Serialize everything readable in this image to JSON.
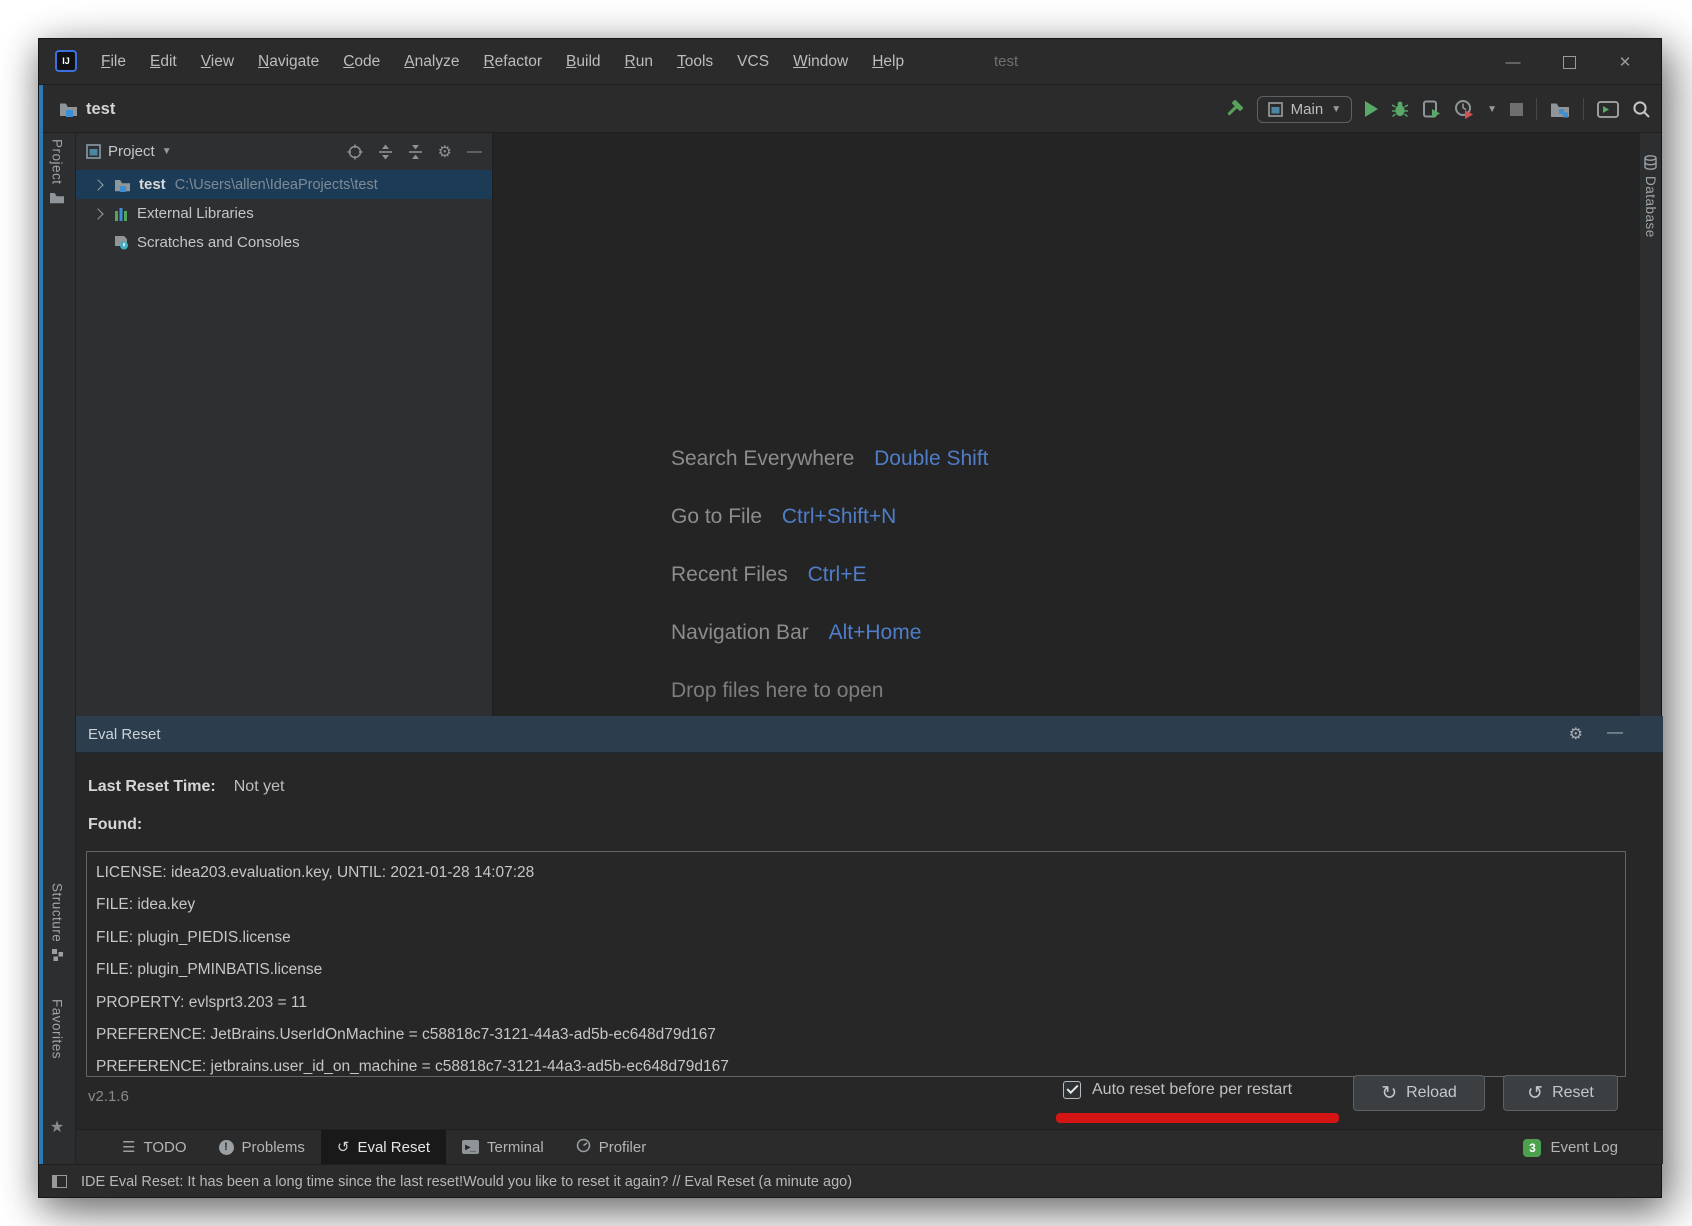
{
  "window": {
    "title": "test",
    "logo_text": "IJ",
    "controls": {
      "minimize": "—",
      "close": "✕"
    }
  },
  "menubar": {
    "items": [
      "File",
      "Edit",
      "View",
      "Navigate",
      "Code",
      "Analyze",
      "Refactor",
      "Build",
      "Run",
      "Tools",
      "VCS",
      "Window",
      "Help"
    ]
  },
  "toolbar": {
    "project_name": "test",
    "run_config": "Main"
  },
  "left_stripe": {
    "project_label": "Project",
    "structure_label": "Structure",
    "favorites_label": "Favorites"
  },
  "right_stripe": {
    "database_label": "Database"
  },
  "project_panel": {
    "header": "Project",
    "tree": [
      {
        "name": "test",
        "path": "C:\\Users\\allen\\IdeaProjects\\test"
      },
      {
        "name": "External Libraries"
      },
      {
        "name": "Scratches and Consoles"
      }
    ]
  },
  "editor_shortcuts": {
    "rows": [
      {
        "label": "Search Everywhere",
        "keys": "Double Shift"
      },
      {
        "label": "Go to File",
        "keys": "Ctrl+Shift+N"
      },
      {
        "label": "Recent Files",
        "keys": "Ctrl+E"
      },
      {
        "label": "Navigation Bar",
        "keys": "Alt+Home"
      }
    ],
    "drop_hint": "Drop files here to open"
  },
  "eval_reset": {
    "title": "Eval Reset",
    "last_reset_label": "Last Reset Time:",
    "last_reset_value": "Not yet",
    "found_label": "Found:",
    "found_items": [
      "LICENSE: idea203.evaluation.key, UNTIL: 2021-01-28 14:07:28",
      "FILE: idea.key",
      "FILE: plugin_PIEDIS.license",
      "FILE: plugin_PMINBATIS.license",
      "PROPERTY: evlsprt3.203 = 11",
      "PREFERENCE: JetBrains.UserIdOnMachine = c58818c7-3121-44a3-ad5b-ec648d79d167",
      "PREFERENCE: jetbrains.user_id_on_machine = c58818c7-3121-44a3-ad5b-ec648d79d167"
    ],
    "version": "v2.1.6",
    "auto_reset_label": "Auto reset before per restart",
    "auto_reset_checked": true,
    "reload_label": "Reload",
    "reset_label": "Reset"
  },
  "bottom_tabs": {
    "items": [
      "TODO",
      "Problems",
      "Eval Reset",
      "Terminal",
      "Profiler"
    ],
    "active": "Eval Reset",
    "event_log": {
      "label": "Event Log",
      "badge": "3"
    }
  },
  "status_bar": {
    "message": "IDE Eval Reset: It has been a long time since the last reset!Would you like to reset it again? // Eval Reset (a minute ago)"
  },
  "colors": {
    "shortcut_key_blue": "#4f7dc8",
    "tree_selection": "#1c3b57",
    "eval_header": "#2c3d4e",
    "annotation_red": "#d51414",
    "run_green": "#59a869",
    "badge_green": "#4da04d"
  }
}
